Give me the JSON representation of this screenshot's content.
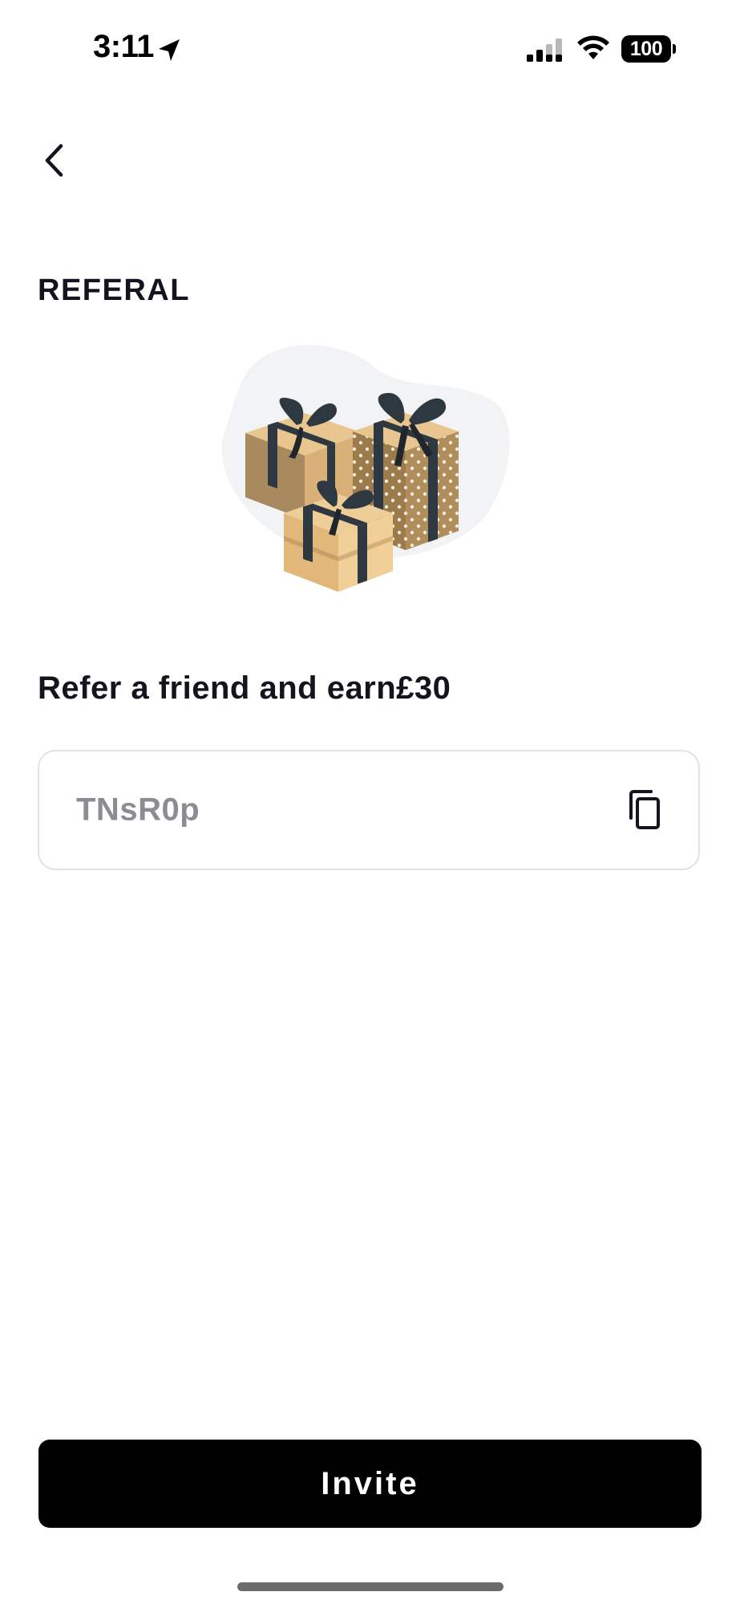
{
  "status_bar": {
    "time": "3:11",
    "battery": "100",
    "icons": [
      "location-arrow-icon",
      "cellular-signal-icon",
      "wifi-icon",
      "battery-icon"
    ]
  },
  "header": {
    "back_icon": "chevron-left-icon"
  },
  "page": {
    "title": "REFERAL",
    "illustration": "gift-boxes-illustration",
    "refer_text": "Refer a friend and earn£30"
  },
  "referral": {
    "code": "TNsR0p",
    "copy_icon": "copy-icon"
  },
  "actions": {
    "invite_label": "Invite"
  },
  "colors": {
    "text": "#14141f",
    "placeholder": "#8c8c92",
    "border": "#e2e2e6",
    "button_bg": "#000000",
    "gift_tan": "#e2b87a",
    "ribbon": "#2e3840"
  }
}
